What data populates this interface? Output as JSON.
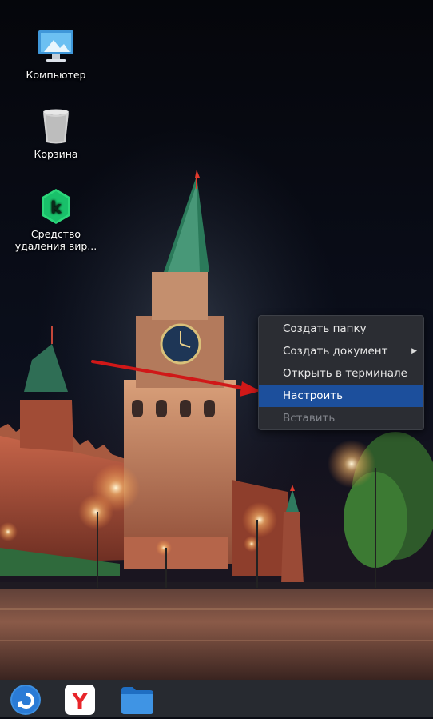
{
  "desktop": {
    "icons": [
      {
        "label": "Компьютер",
        "icon": "computer-icon"
      },
      {
        "label": "Корзина",
        "icon": "trash-icon"
      },
      {
        "label_line1": "Средство",
        "label_line2": "удаления вир...",
        "icon": "kaspersky-icon"
      }
    ]
  },
  "context_menu": {
    "items": [
      {
        "label": "Создать папку"
      },
      {
        "label": "Создать документ",
        "has_submenu": true
      },
      {
        "label": "Открыть в терминале"
      },
      {
        "label": "Настроить",
        "state": "highlighted"
      },
      {
        "label": "Вставить",
        "state": "disabled"
      }
    ],
    "submenu_arrow": "▶"
  },
  "taskbar": {
    "items": [
      {
        "icon": "start-menu-icon"
      },
      {
        "icon": "yandex-browser-icon",
        "glyph": "Y"
      },
      {
        "icon": "file-manager-icon"
      }
    ]
  },
  "colors": {
    "menu_bg": "#2b2d33",
    "menu_highlight": "#1c4f9c",
    "annotation_arrow": "#d01818",
    "taskbar_bg": "#272a30"
  }
}
